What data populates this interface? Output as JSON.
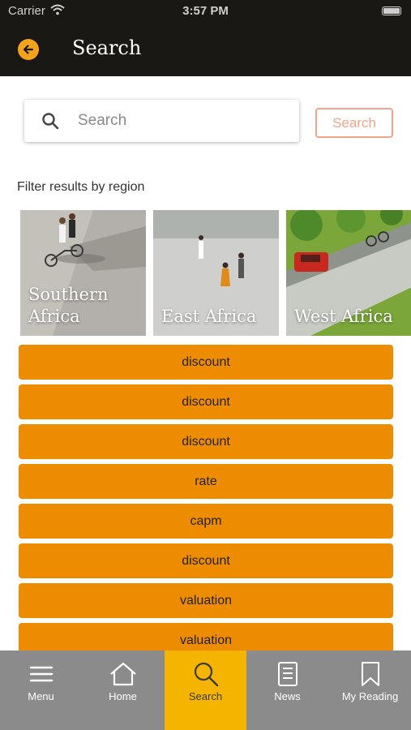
{
  "status_bar": {
    "carrier": "Carrier",
    "time": "3:57 PM"
  },
  "header": {
    "title": "Search",
    "back_icon": "arrow-left-circle-icon",
    "accent_color": "#f5a31a"
  },
  "search": {
    "placeholder": "Search",
    "value": "",
    "button_label": "Search"
  },
  "filter": {
    "label": "Filter results by region",
    "regions": [
      {
        "name": "Southern Africa",
        "image": "cyclists-on-road"
      },
      {
        "name": "East Africa",
        "image": "people-in-plaza"
      },
      {
        "name": "West Africa",
        "image": "red-car-on-street"
      }
    ]
  },
  "results": {
    "color": "#ee8c00",
    "items": [
      "discount",
      "discount",
      "discount",
      "rate",
      "capm",
      "discount",
      "valuation",
      "valuation"
    ]
  },
  "tab_bar": {
    "active": "Search",
    "active_color": "#f5b400",
    "tabs": [
      {
        "label": "Menu",
        "icon": "hamburger-menu-icon"
      },
      {
        "label": "Home",
        "icon": "home-icon"
      },
      {
        "label": "Search",
        "icon": "search-icon"
      },
      {
        "label": "News",
        "icon": "news-document-icon"
      },
      {
        "label": "My Reading",
        "icon": "bookmark-icon"
      }
    ]
  }
}
